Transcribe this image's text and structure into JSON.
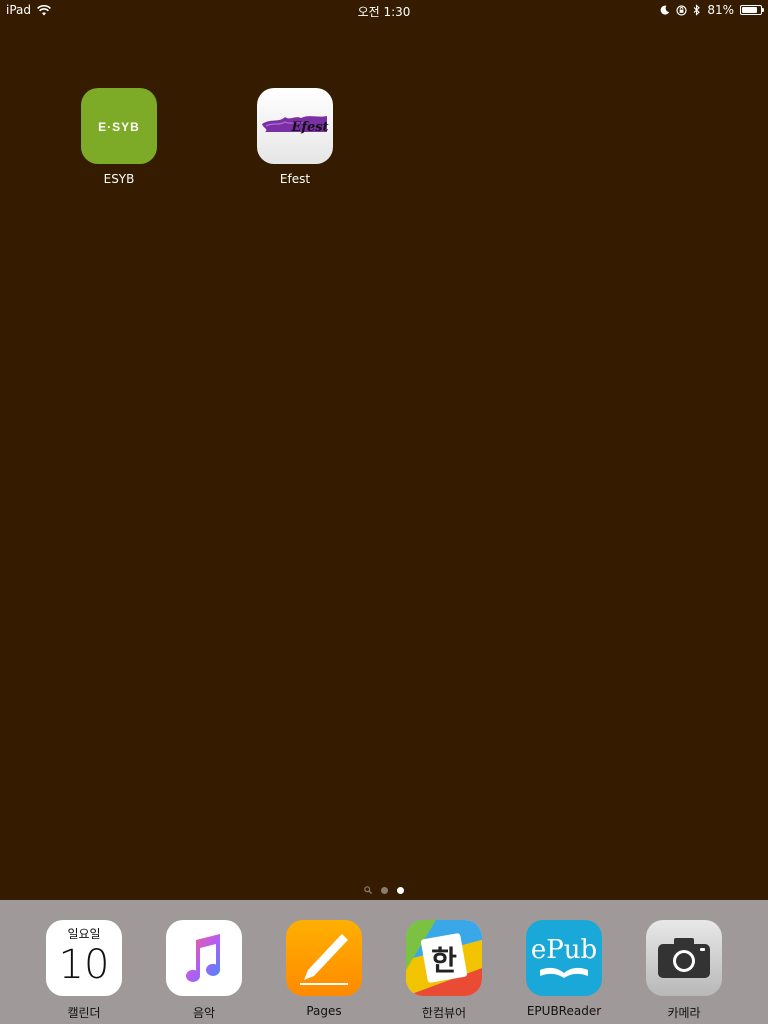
{
  "status_bar": {
    "device": "iPad",
    "time": "오전 1:30",
    "battery_percent": "81%",
    "battery_level": 0.81
  },
  "home_apps": [
    {
      "name": "ESYB",
      "icon_text": "E·SYB",
      "color": "#7dab27"
    },
    {
      "name": "Efest",
      "icon_text": "Efest",
      "color": "#7a2fa0"
    }
  ],
  "page_indicator": {
    "pages": 2,
    "current": 2
  },
  "dock_apps": [
    {
      "name": "캘린더",
      "weekday": "일요일",
      "day": "10"
    },
    {
      "name": "음악"
    },
    {
      "name": "Pages"
    },
    {
      "name": "한컴뷰어",
      "glyph": "한"
    },
    {
      "name": "EPUBReader",
      "icon_text": "ePub"
    },
    {
      "name": "카메라"
    }
  ]
}
